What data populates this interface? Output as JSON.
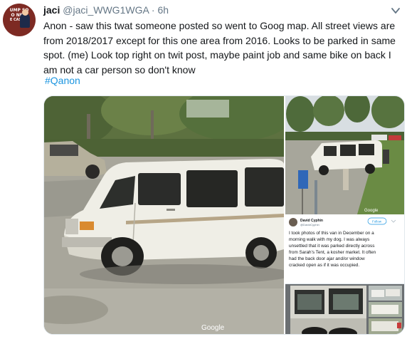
{
  "tweet": {
    "display_name": "jaci",
    "handle": "@jaci_WWG1WGA",
    "separator": "·",
    "time": "6h",
    "text": "Anon - saw this twat someone posted so went to Goog map. All street views are from 2018/2017 except for this one area from 2016. Looks to be parked in same spot. (me) Look top right on twit post, maybe paint job and same bike on back  I am not a car person so don't know",
    "hashtag": "#Qanon",
    "avatar_text": [
      "UMP SO",
      "O NEW",
      "E CASTLE"
    ]
  },
  "media": {
    "watermark_main": "Google",
    "watermark_small": "Google",
    "embedded_post": {
      "author": "David Cyphin",
      "author_handle": "@DavidCyphin",
      "follow_label": "Follow",
      "text_lines": [
        "I took photos of this van in December on a",
        "morning walk with my dog. I was always",
        "unsettled that it was parked directly across",
        "from Sarah's  Tent, a kosher market. It often",
        "had the back door ajar and/or window",
        "cracked open as if it was occupied."
      ]
    }
  },
  "icons": {
    "caret": "chevron-down-icon"
  },
  "colors": {
    "link": "#1b95e0",
    "secondary": "#657786",
    "text": "#14171a"
  }
}
